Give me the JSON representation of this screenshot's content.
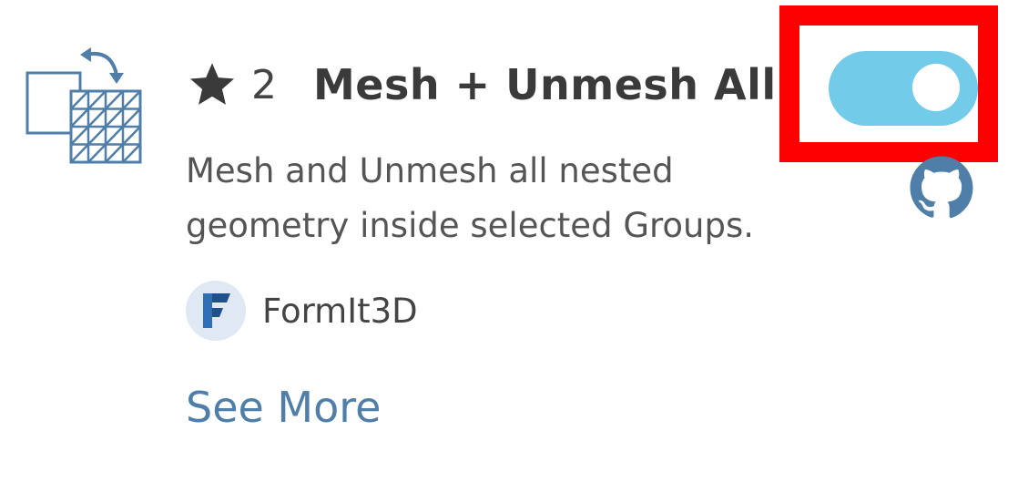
{
  "plugin": {
    "icon": "mesh-unmesh-icon",
    "star_icon": "star-icon",
    "stars": "2",
    "title": "Mesh + Unmesh All",
    "description": "Mesh and Unmesh all nested geometry inside selected Groups.",
    "enabled": true,
    "github_icon": "github-icon"
  },
  "author": {
    "avatar_icon": "formit-logo-icon",
    "name": "FormIt3D"
  },
  "links": {
    "see_more": "See More"
  },
  "colors": {
    "toggle_on": "#72cbe8",
    "highlight": "#ff0000",
    "link": "#4f7fa8",
    "icon_blue": "#4f7fa8"
  }
}
